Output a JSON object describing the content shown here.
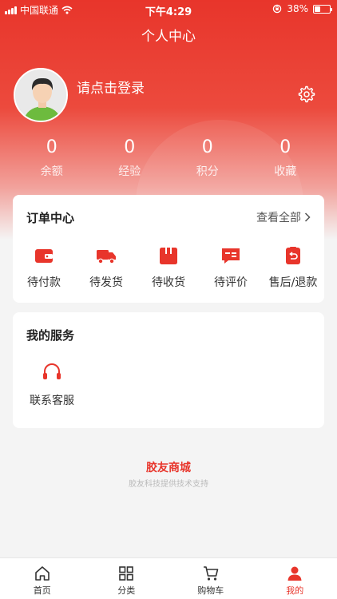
{
  "status_bar": {
    "carrier": "中国联通",
    "time": "下午4:29",
    "battery": "38%",
    "battery_level": 0.38
  },
  "header": {
    "title": "个人中心"
  },
  "profile": {
    "login_prompt": "请点击登录"
  },
  "stats": [
    {
      "value": "0",
      "label": "余额"
    },
    {
      "value": "0",
      "label": "经验"
    },
    {
      "value": "0",
      "label": "积分"
    },
    {
      "value": "0",
      "label": "收藏"
    }
  ],
  "orders": {
    "title": "订单中心",
    "view_all": "查看全部",
    "items": [
      {
        "label": "待付款",
        "icon": "wallet-icon"
      },
      {
        "label": "待发货",
        "icon": "truck-icon"
      },
      {
        "label": "待收货",
        "icon": "package-icon"
      },
      {
        "label": "待评价",
        "icon": "review-icon"
      },
      {
        "label": "售后/退款",
        "icon": "refund-icon"
      }
    ]
  },
  "services": {
    "title": "我的服务",
    "items": [
      {
        "label": "联系客服",
        "icon": "headset-icon"
      }
    ]
  },
  "brand": {
    "name": "胶友商城",
    "tagline": "胶友科技提供技术支持"
  },
  "tabs": [
    {
      "label": "首页",
      "icon": "home-icon"
    },
    {
      "label": "分类",
      "icon": "grid-icon"
    },
    {
      "label": "购物车",
      "icon": "cart-icon"
    },
    {
      "label": "我的",
      "icon": "user-icon",
      "active": true
    }
  ],
  "colors": {
    "accent": "#e8352b",
    "background": "#f4f4f4"
  }
}
